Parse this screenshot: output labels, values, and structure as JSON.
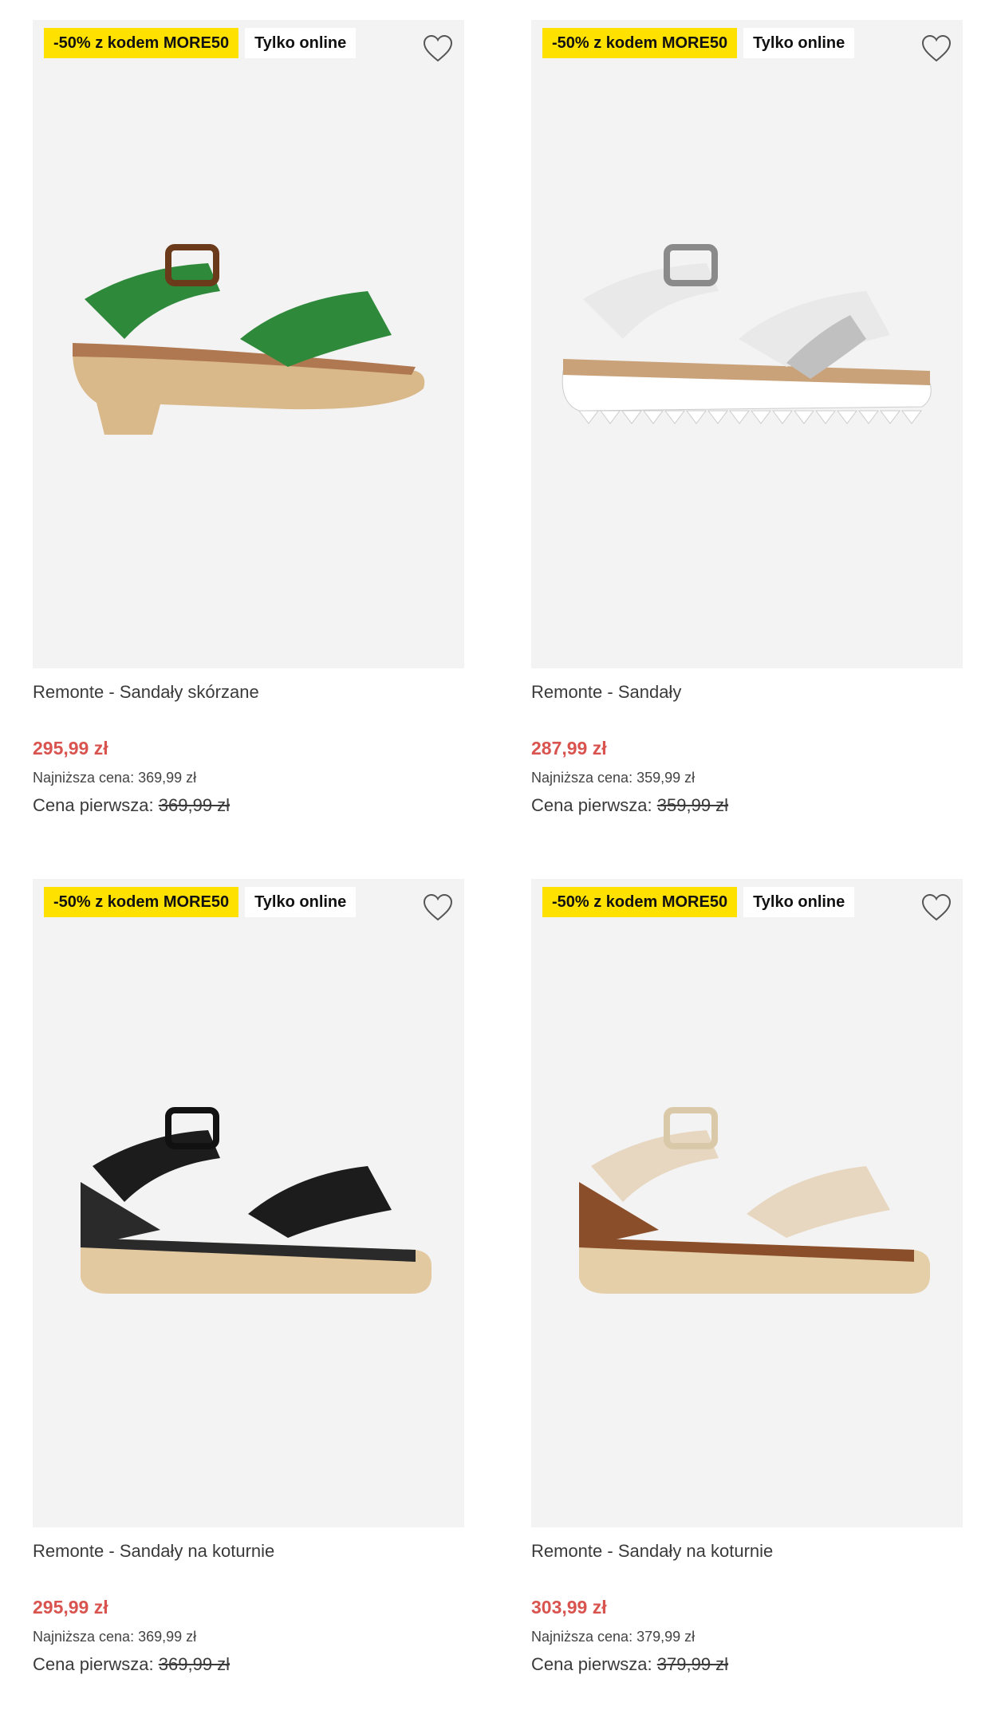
{
  "products": [
    {
      "promo_badge": "-50% z kodem MORE50",
      "online_badge": "Tylko online",
      "name": "Remonte - Sandały skórzane",
      "price": "295,99 zł",
      "lowest_price": "Najniższa cena: 369,99 zł",
      "first_price_label": "Cena pierwsza:",
      "first_price_value": "369,99 zł",
      "colors": {
        "upper": "#2e8a3a",
        "sole": "#d9b88a",
        "insole": "#b07850",
        "buckle": "#6a3a1a"
      }
    },
    {
      "promo_badge": "-50% z kodem MORE50",
      "online_badge": "Tylko online",
      "name": "Remonte - Sandały",
      "price": "287,99 zł",
      "lowest_price": "Najniższa cena: 359,99 zł",
      "first_price_label": "Cena pierwsza:",
      "first_price_value": "359,99 zł",
      "colors": {
        "upper": "#e9e9e9",
        "sole": "#ffffff",
        "insole": "#c9a27a",
        "buckle": "#8a8a8a"
      }
    },
    {
      "promo_badge": "-50% z kodem MORE50",
      "online_badge": "Tylko online",
      "name": "Remonte - Sandały na koturnie",
      "price": "295,99 zł",
      "lowest_price": "Najniższa cena: 369,99 zł",
      "first_price_label": "Cena pierwsza:",
      "first_price_value": "369,99 zł",
      "colors": {
        "upper": "#1c1c1c",
        "sole": "#e3c9a0",
        "insole": "#2a2a2a",
        "buckle": "#111111"
      }
    },
    {
      "promo_badge": "-50% z kodem MORE50",
      "online_badge": "Tylko online",
      "name": "Remonte - Sandały na koturnie",
      "price": "303,99 zł",
      "lowest_price": "Najniższa cena: 379,99 zł",
      "first_price_label": "Cena pierwsza:",
      "first_price_value": "379,99 zł",
      "colors": {
        "upper": "#e8d7c0",
        "sole": "#e5cfa8",
        "insole": "#8a4f2a",
        "buckle": "#d9c9a8"
      }
    }
  ],
  "icons": {
    "favorite": "heart-outline-icon"
  },
  "theme": {
    "promo_color": "#ffe100",
    "price_color": "#d9534f",
    "card_bg": "#f3f3f3"
  }
}
